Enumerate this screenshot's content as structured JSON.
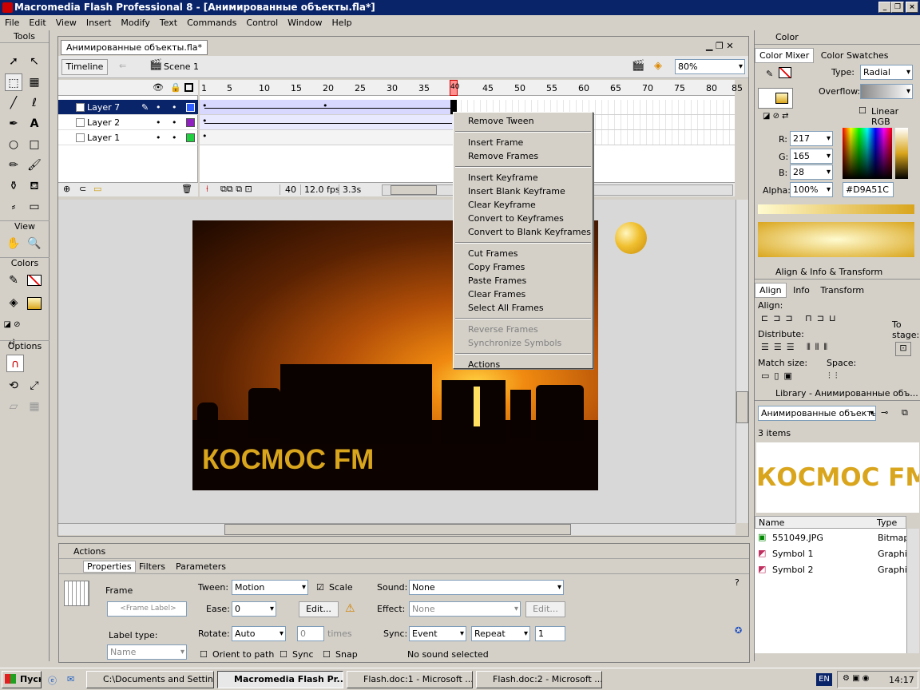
{
  "window": {
    "title": "Macromedia Flash Professional 8 - [Анимированные объекты.fla*]"
  },
  "menu": [
    "File",
    "Edit",
    "View",
    "Insert",
    "Modify",
    "Text",
    "Commands",
    "Control",
    "Window",
    "Help"
  ],
  "tools": {
    "title": "Tools",
    "view": "View",
    "colors": "Colors",
    "options": "Options"
  },
  "doc": {
    "tab": "Анимированные объекты.fla*",
    "timeline_btn": "Timeline",
    "scene": "Scene 1",
    "zoom": "80%"
  },
  "layers": [
    {
      "name": "Layer 7"
    },
    {
      "name": "Layer 2"
    },
    {
      "name": "Layer 1"
    }
  ],
  "ruler": [
    "1",
    "5",
    "10",
    "15",
    "20",
    "25",
    "30",
    "35",
    "40",
    "45",
    "50",
    "55",
    "60",
    "65",
    "70",
    "75",
    "80",
    "85"
  ],
  "timeline_status": {
    "frame": "40",
    "fps": "12.0 fps",
    "time": "3.3s"
  },
  "stage_text": "КОСМОС FM",
  "context_menu": [
    "Remove Tween",
    "Insert Frame",
    "Remove Frames",
    "Insert Keyframe",
    "Insert Blank Keyframe",
    "Clear Keyframe",
    "Convert to Keyframes",
    "Convert to Blank Keyframes",
    "Cut Frames",
    "Copy Frames",
    "Paste Frames",
    "Clear Frames",
    "Select All Frames",
    "Reverse Frames",
    "Synchronize Symbols",
    "Actions"
  ],
  "props": {
    "actions": "Actions",
    "tabs": [
      "Properties",
      "Filters",
      "Parameters"
    ],
    "frame": "Frame",
    "frame_label": "<Frame Label>",
    "label_type": "Label type:",
    "label_type_val": "Name",
    "tween": "Tween:",
    "tween_val": "Motion",
    "scale": "Scale",
    "ease": "Ease:",
    "ease_val": "0",
    "edit": "Edit...",
    "rotate": "Rotate:",
    "rotate_val": "Auto",
    "rotate_n": "0",
    "times": "times",
    "orient": "Orient to path",
    "sync": "Sync",
    "snap": "Snap",
    "sound": "Sound:",
    "sound_val": "None",
    "effect": "Effect:",
    "effect_val": "None",
    "edit2": "Edit...",
    "sync2": "Sync:",
    "sync_val": "Event",
    "repeat_val": "Repeat",
    "repeat_n": "1",
    "no_sound": "No sound selected"
  },
  "color": {
    "title": "Color",
    "tab1": "Color Mixer",
    "tab2": "Color Swatches",
    "type": "Type:",
    "type_val": "Radial",
    "overflow": "Overflow:",
    "linear": "Linear RGB",
    "r": "R:",
    "r_val": "217",
    "g": "G:",
    "g_val": "165",
    "b": "B:",
    "b_val": "28",
    "alpha": "Alpha:",
    "alpha_val": "100%",
    "hex": "#D9A51C"
  },
  "align": {
    "title": "Align & Info & Transform",
    "tabs": [
      "Align",
      "Info",
      "Transform"
    ],
    "align": "Align:",
    "distribute": "Distribute:",
    "match": "Match size:",
    "space": "Space:",
    "to_stage": "To stage:"
  },
  "library": {
    "title": "Library - Анимированные объ...",
    "doc": "Анимированные объекть",
    "items_count": "3 items",
    "preview": "КОСМОС FM",
    "col_name": "Name",
    "col_type": "Type",
    "items": [
      {
        "name": "551049.JPG",
        "type": "Bitmap"
      },
      {
        "name": "Symbol 1",
        "type": "Graphic"
      },
      {
        "name": "Symbol 2",
        "type": "Graphic"
      }
    ]
  },
  "taskbar": {
    "start": "Пуск",
    "items": [
      "C:\\Documents and Settin...",
      "Macromedia Flash Pr...",
      "Flash.doc:1 - Microsoft ...",
      "Flash.doc:2 - Microsoft ..."
    ],
    "lang": "EN",
    "clock": "14:17"
  }
}
